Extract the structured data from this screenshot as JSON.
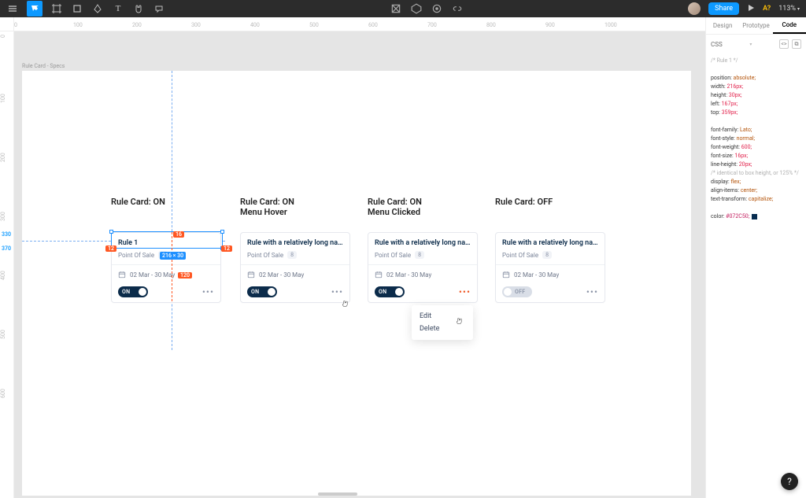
{
  "toolbar": {
    "share": "Share",
    "dev": "A?",
    "zoom": "113%"
  },
  "sidepanel": {
    "tabs": [
      "Design",
      "Prototype",
      "Code"
    ],
    "css_label": "CSS",
    "comment1": "/* Rule 1 */",
    "line_position": "position: ",
    "val_position": "absolute;",
    "line_width": "width: ",
    "val_width": "216px;",
    "line_height": "height: ",
    "val_height": "30px;",
    "line_left": "left: ",
    "val_left": "167px;",
    "line_top": "top: ",
    "val_top": "359px;",
    "line_ff": "font-family: ",
    "val_ff": "Lato;",
    "line_fs": "font-style: ",
    "val_fs": "normal;",
    "line_fw": "font-weight: ",
    "val_fw": "600;",
    "line_fsize": "font-size: ",
    "val_fsize": "16px;",
    "line_lh": "line-height: ",
    "val_lh": "20px;",
    "comment2": "/* identical to box height, or 125% */",
    "line_disp": "display: ",
    "val_disp": "flex;",
    "line_ai": "align-items: ",
    "val_ai": "center;",
    "line_tt": "text-transform: ",
    "val_tt": "capitalize;",
    "line_color": "color: ",
    "val_color": "#072C50;"
  },
  "frame": {
    "name": "Rule Card - Specs"
  },
  "ruler_h": [
    "0",
    "100",
    "200",
    "300",
    "400",
    "500",
    "600",
    "700",
    "800",
    "900",
    "1000"
  ],
  "ruler_v": [
    "0",
    "100",
    "200",
    "300",
    "400",
    "500",
    "600"
  ],
  "marker1": "330",
  "marker2": "370",
  "cols": [
    {
      "title": "Rule Card: ON"
    },
    {
      "title": "Rule Card: ON\nMenu Hover"
    },
    {
      "title": "Rule Card: ON\nMenu Clicked"
    },
    {
      "title": "Rule Card: OFF"
    }
  ],
  "cards": {
    "c1": {
      "title": "Rule 1",
      "tag": "Point Of Sale",
      "badge": "8",
      "date": "02 Mar - 30 May",
      "toggle": "ON"
    },
    "c2": {
      "title": "Rule with a relatively long na...",
      "tag": "Point Of Sale",
      "badge": "8",
      "date": "02 Mar - 30 May",
      "toggle": "ON"
    },
    "c3": {
      "title": "Rule with a relatively long na...",
      "tag": "Point Of Sale",
      "badge": "8",
      "date": "02 Mar - 30 May",
      "toggle": "ON"
    },
    "c4": {
      "title": "Rule with a relatively long na...",
      "tag": "Point Of Sale",
      "badge": "8",
      "date": "02 Mar - 30 May",
      "toggle": "OFF"
    }
  },
  "menu": {
    "edit": "Edit",
    "delete": "Delete"
  },
  "sel": {
    "dim": "216 × 30",
    "g16": "16",
    "g12": "12",
    "g120": "120"
  }
}
